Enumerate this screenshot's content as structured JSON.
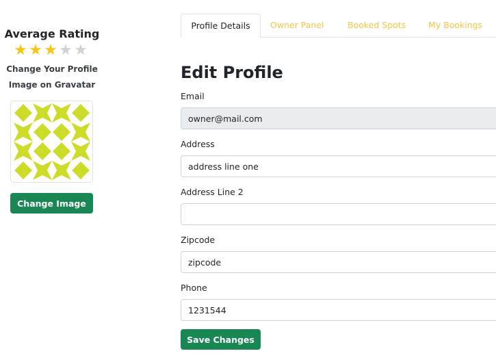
{
  "sidebar": {
    "rating_title": "Average Rating",
    "rating": {
      "value": 3,
      "max": 5
    },
    "stars": [
      "★",
      "★",
      "★",
      "★",
      "★"
    ],
    "gravatar_note_line1": "Change Your Profile",
    "gravatar_note_line2": "Image on Gravatar",
    "change_image_label": "Change Image",
    "avatar_colors": {
      "primary": "#cddc29",
      "background": "#ffffff"
    }
  },
  "tabs": [
    {
      "label": "Profile Details",
      "active": true
    },
    {
      "label": "Owner Panel",
      "active": false
    },
    {
      "label": "Booked Spots",
      "active": false
    },
    {
      "label": "My Bookings",
      "active": false
    }
  ],
  "form": {
    "title": "Edit Profile",
    "email": {
      "label": "Email",
      "value": "owner@mail.com"
    },
    "address": {
      "label": "Address",
      "value": "address line one"
    },
    "address2": {
      "label": "Address Line 2",
      "value": ""
    },
    "zipcode": {
      "label": "Zipcode",
      "value": "zipcode"
    },
    "phone": {
      "label": "Phone",
      "value": "1231544"
    },
    "save_label": "Save Changes"
  },
  "colors": {
    "accent_green": "#198754",
    "tab_link": "#f5c542",
    "star_on": "#f5c518",
    "star_off": "#cfd2d5"
  }
}
